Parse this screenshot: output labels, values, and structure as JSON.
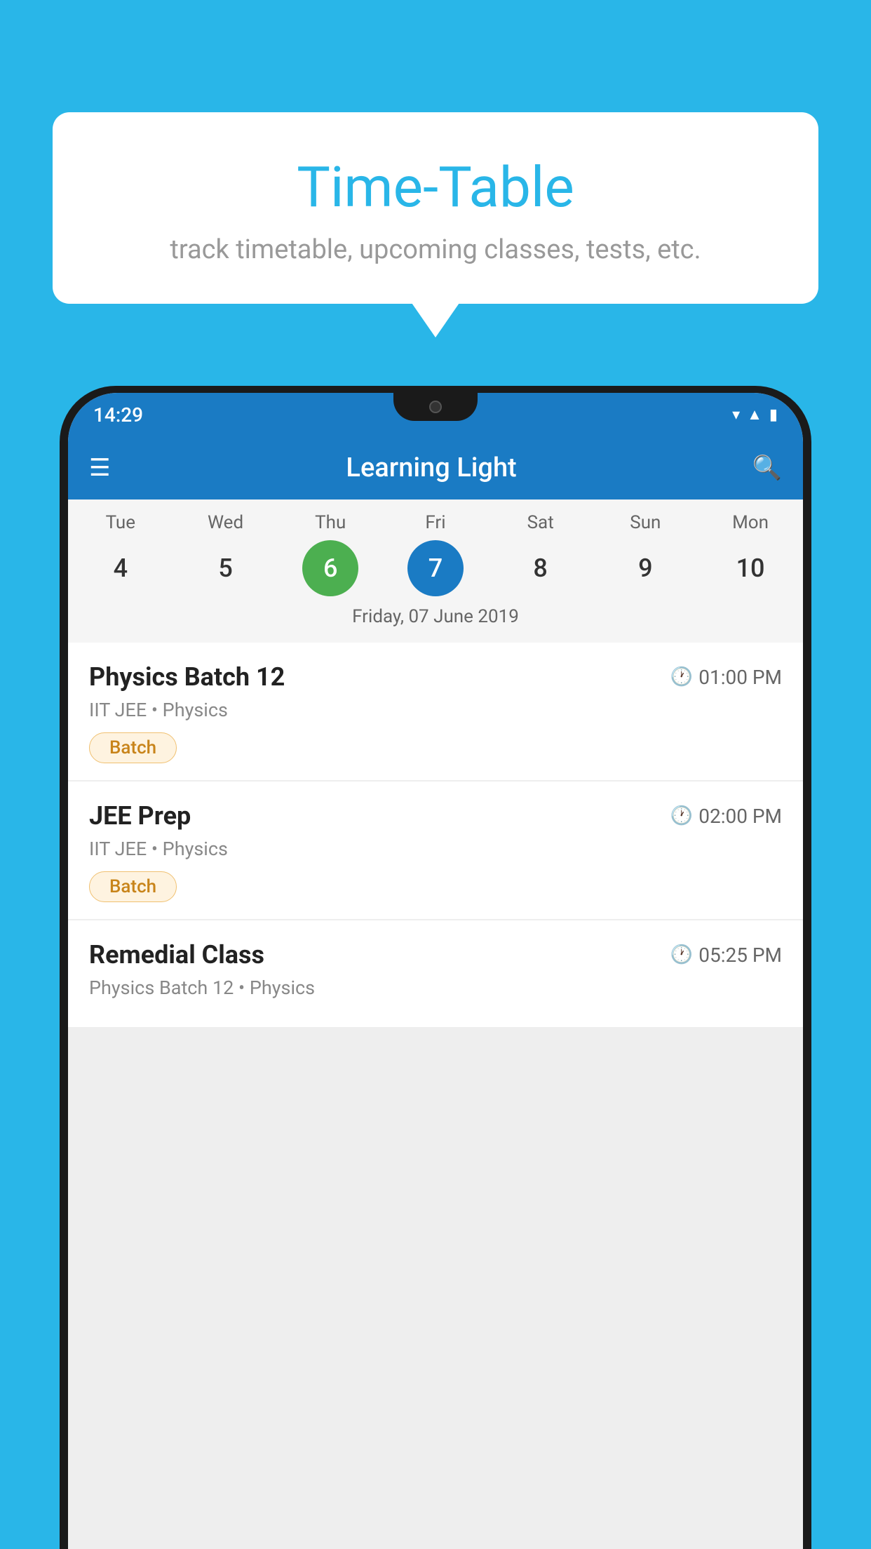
{
  "background": {
    "color": "#29b6e8"
  },
  "speech_bubble": {
    "title": "Time-Table",
    "subtitle": "track timetable, upcoming classes, tests, etc."
  },
  "phone": {
    "status_bar": {
      "time": "14:29"
    },
    "app_bar": {
      "title": "Learning Light"
    },
    "calendar": {
      "days": [
        {
          "label": "Tue",
          "number": "4"
        },
        {
          "label": "Wed",
          "number": "5"
        },
        {
          "label": "Thu",
          "number": "6",
          "state": "today"
        },
        {
          "label": "Fri",
          "number": "7",
          "state": "selected"
        },
        {
          "label": "Sat",
          "number": "8"
        },
        {
          "label": "Sun",
          "number": "9"
        },
        {
          "label": "Mon",
          "number": "10"
        }
      ],
      "selected_date": "Friday, 07 June 2019"
    },
    "classes": [
      {
        "name": "Physics Batch 12",
        "time": "01:00 PM",
        "meta": "IIT JEE • Physics",
        "badge": "Batch"
      },
      {
        "name": "JEE Prep",
        "time": "02:00 PM",
        "meta": "IIT JEE • Physics",
        "badge": "Batch"
      },
      {
        "name": "Remedial Class",
        "time": "05:25 PM",
        "meta": "Physics Batch 12 • Physics",
        "badge": ""
      }
    ]
  }
}
